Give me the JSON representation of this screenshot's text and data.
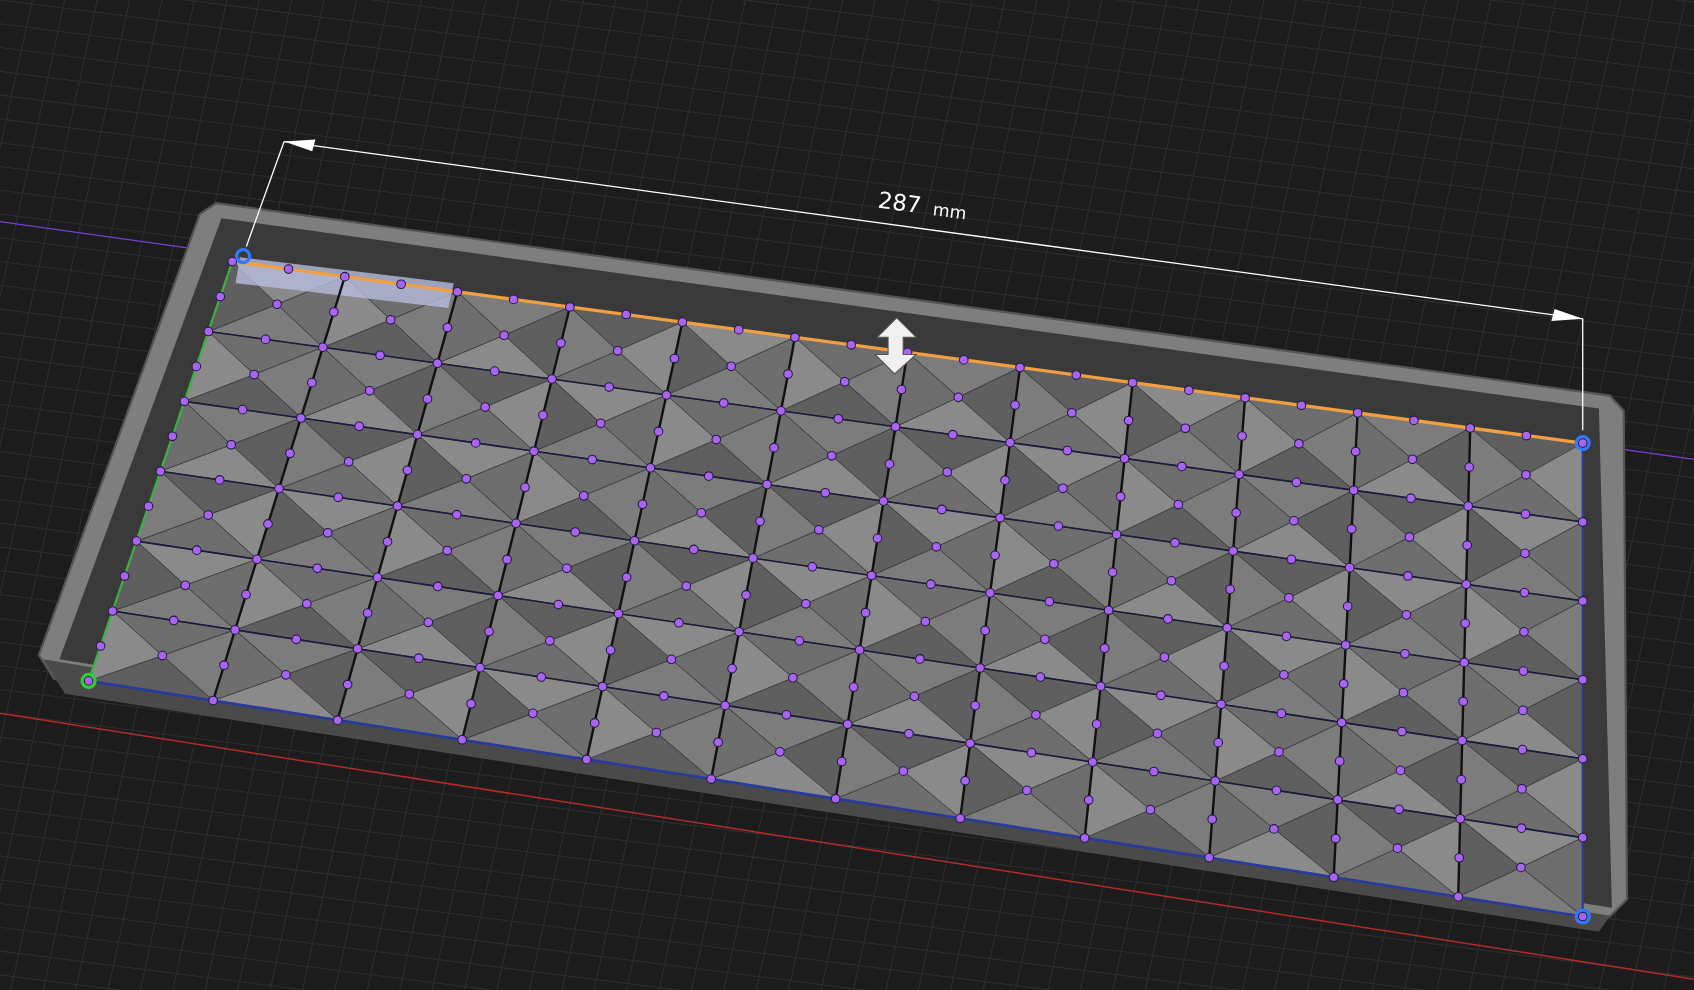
{
  "viewport": {
    "dimension": {
      "value": "287",
      "unit": "mm"
    }
  }
}
